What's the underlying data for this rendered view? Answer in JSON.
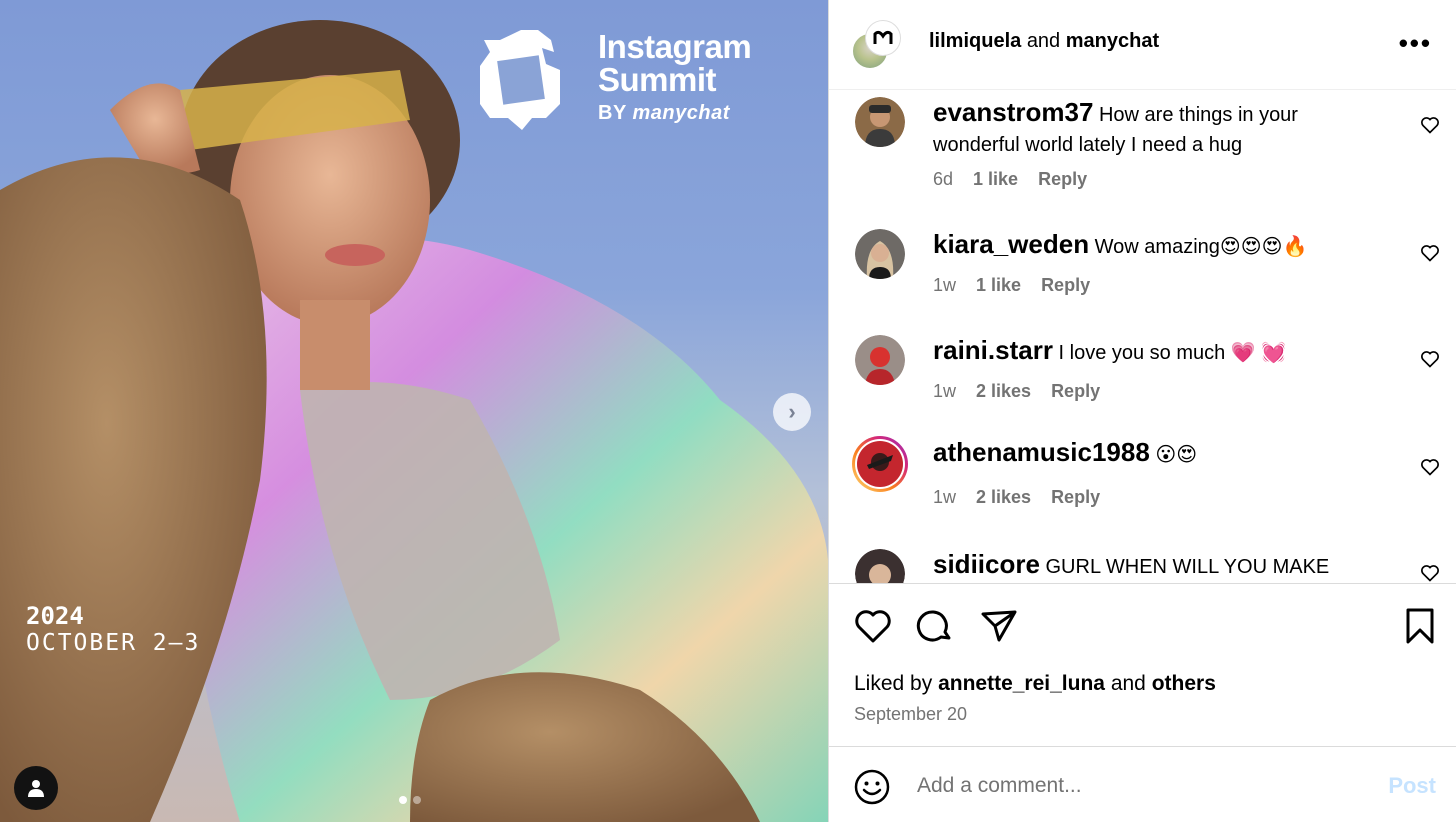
{
  "media": {
    "summit_title_line1": "Instagram",
    "summit_title_line2": "Summit",
    "summit_by": "BY",
    "summit_brand": "manychat",
    "year": "2024",
    "dates": "OCTOBER 2–3",
    "next_icon": "›"
  },
  "header": {
    "author": "lilmiquela",
    "conjunction": "and",
    "collaborator": "manychat",
    "more_icon": "•••"
  },
  "comments": [
    {
      "user": "evanstrom37",
      "text": "How are things in your wonderful world lately I need a hug",
      "age": "6d",
      "likes": "1 like",
      "reply": "Reply"
    },
    {
      "user": "kiara_weden",
      "text": "Wow amazing😍😍😍🔥",
      "age": "1w",
      "likes": "1 like",
      "reply": "Reply"
    },
    {
      "user": "raini.starr",
      "text": "I love you so much 💗 💓",
      "age": "1w",
      "likes": "2 likes",
      "reply": "Reply"
    },
    {
      "user": "athenamusic1988",
      "text": "😮😍",
      "age": "1w",
      "likes": "2 likes",
      "reply": "Reply"
    },
    {
      "user": "sidiicore",
      "text": "GURL WHEN WILL YOU MAKE"
    }
  ],
  "footer": {
    "liked_prefix": "Liked by",
    "liked_user": "annette_rei_luna",
    "liked_and": "and",
    "liked_others": "others",
    "date": "September 20"
  },
  "composer": {
    "placeholder": "Add a comment...",
    "post_label": "Post"
  }
}
